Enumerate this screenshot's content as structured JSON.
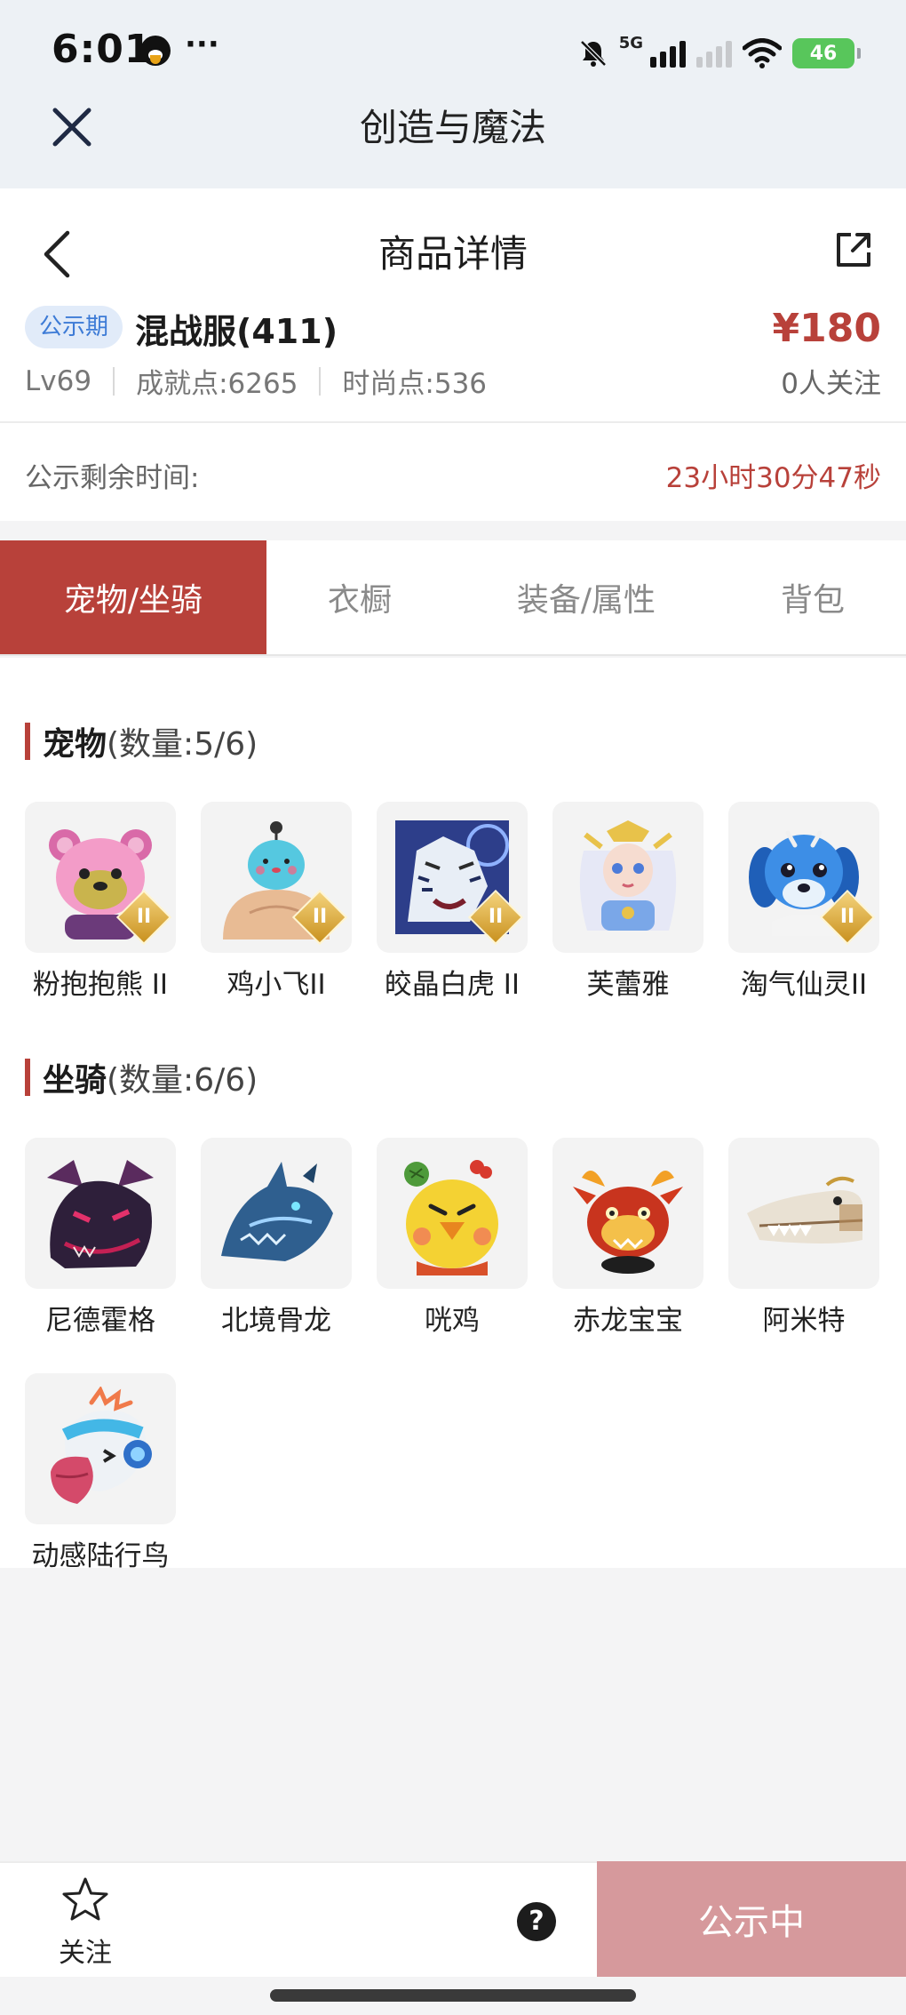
{
  "status_bar": {
    "time": "6:01",
    "dots": "···",
    "network": "5G",
    "battery": "46"
  },
  "titlebar": {
    "title": "创造与魔法"
  },
  "nav": {
    "title": "商品详情"
  },
  "product": {
    "badge": "公示期",
    "server": "混战服(411)",
    "price": "¥180",
    "level": "Lv69",
    "achievement": "成就点:6265",
    "fashion": "时尚点:536",
    "followers": "0人关注"
  },
  "countdown": {
    "label": "公示剩余时间:",
    "value": "23小时30分47秒"
  },
  "tabs": [
    {
      "label": "宠物/坐骑",
      "active": true
    },
    {
      "label": "衣橱",
      "active": false
    },
    {
      "label": "装备/属性",
      "active": false
    },
    {
      "label": "背包",
      "active": false
    }
  ],
  "pets": {
    "title": "宠物",
    "count": "(数量:5/6)",
    "items": [
      {
        "name": "粉抱抱熊 II",
        "tier": "II",
        "icon": "pink-bear-icon"
      },
      {
        "name": "鸡小飞II",
        "tier": "II",
        "icon": "blue-chick-icon"
      },
      {
        "name": "皎晶白虎 II",
        "tier": "II",
        "icon": "white-tiger-icon"
      },
      {
        "name": "芙蕾雅",
        "tier": "",
        "icon": "freya-fairy-icon"
      },
      {
        "name": "淘气仙灵II",
        "tier": "II",
        "icon": "blue-pup-icon"
      }
    ]
  },
  "mounts": {
    "title": "坐骑",
    "count": "(数量:6/6)",
    "items": [
      {
        "name": "尼德霍格",
        "icon": "dark-dragon-icon"
      },
      {
        "name": "北境骨龙",
        "icon": "bone-dragon-icon"
      },
      {
        "name": "咣鸡",
        "icon": "yellow-chicken-icon"
      },
      {
        "name": "赤龙宝宝",
        "icon": "red-dragon-icon"
      },
      {
        "name": "阿米特",
        "icon": "crocodile-icon"
      },
      {
        "name": "动感陆行鸟",
        "icon": "headphone-bird-icon"
      }
    ]
  },
  "bottom": {
    "fav_label": "关注",
    "help_label": "?",
    "action_label": "公示中"
  },
  "colors": {
    "accent": "#b8413a",
    "badge_bg": "#e1ebf9",
    "badge_text": "#3d7bd6",
    "action_bg": "#d6999c"
  }
}
